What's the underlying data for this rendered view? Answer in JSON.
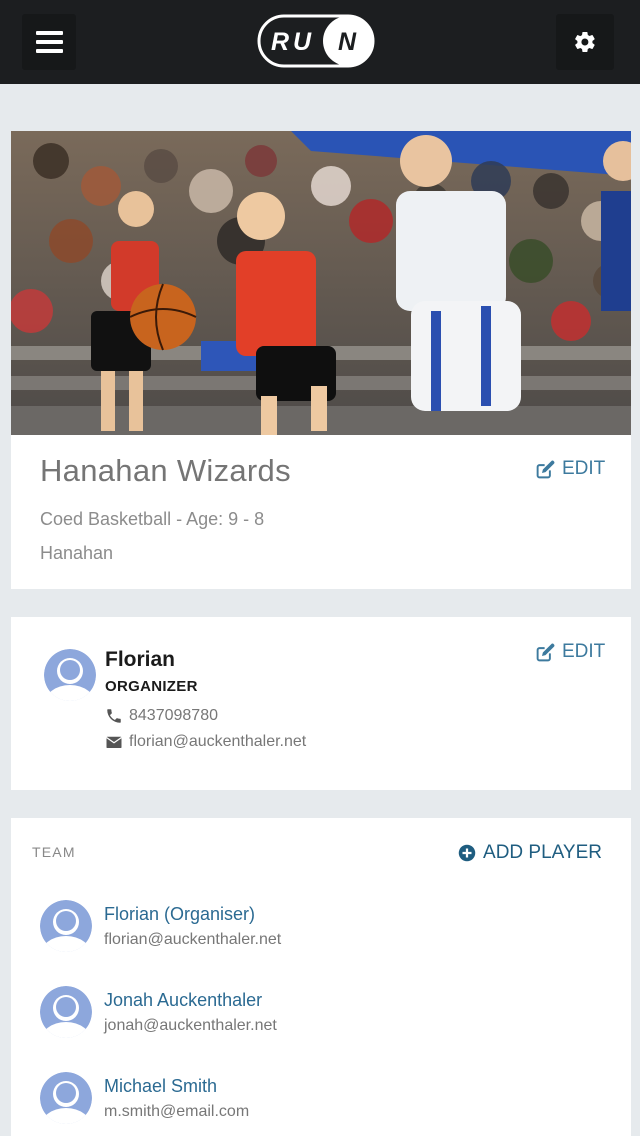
{
  "header": {
    "logo_text_left": "RU",
    "logo_text_right": "N",
    "menu_icon": "hamburger-icon",
    "settings_icon": "gear-icon"
  },
  "team_card": {
    "photo_icon": "team-photo",
    "name": "Hanahan Wizards",
    "subtitle": "Coed Basketball - Age: 9 - 8",
    "location": "Hanahan",
    "edit_label": "EDIT"
  },
  "organizer_card": {
    "name": "Florian",
    "role": "ORGANIZER",
    "phone": "8437098780",
    "email": "florian@auckenthaler.net",
    "edit_label": "EDIT"
  },
  "team_list": {
    "heading": "TEAM",
    "add_label": "ADD PLAYER",
    "players": [
      {
        "name": "Florian (Organiser)",
        "email": "florian@auckenthaler.net"
      },
      {
        "name": "Jonah Auckenthaler",
        "email": "jonah@auckenthaler.net"
      },
      {
        "name": "Michael Smith",
        "email": "m.smith@email.com"
      }
    ]
  },
  "colors": {
    "header_bg": "#1c1e20",
    "page_bg": "#e6eaed",
    "link": "#3d7a9e",
    "avatar": "#8da7dc"
  }
}
